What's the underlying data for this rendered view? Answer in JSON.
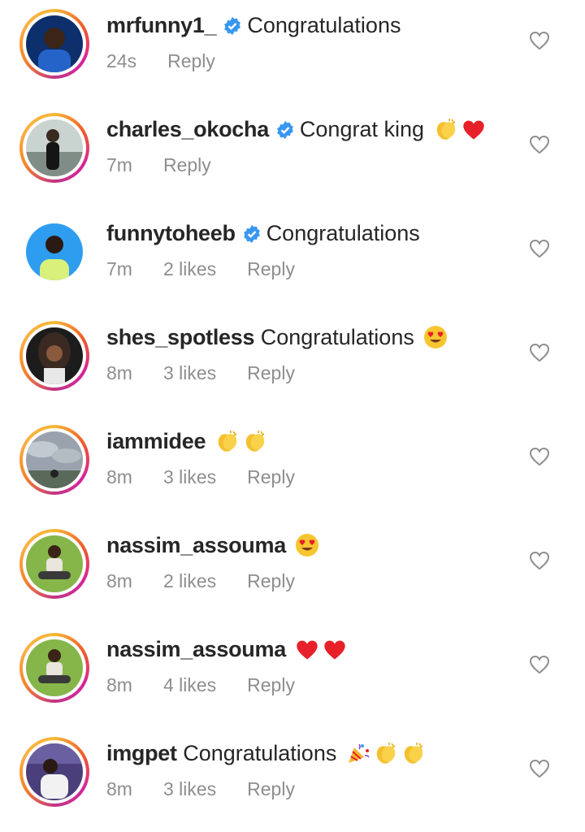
{
  "comments": [
    {
      "username": "mrfunny1_",
      "verified": true,
      "text": "Congratulations",
      "emojis": [],
      "time": "24s",
      "likes": "",
      "reply": "Reply",
      "ring": true,
      "avatar": "blue"
    },
    {
      "username": "charles_okocha",
      "verified": true,
      "text": "Congrat king",
      "emojis": [
        "clapping-hands",
        "red-heart"
      ],
      "time": "7m",
      "likes": "",
      "reply": "Reply",
      "ring": true,
      "avatar": "outdoor"
    },
    {
      "username": "funnytoheeb",
      "verified": true,
      "text": "Congratulations",
      "emojis": [],
      "time": "7m",
      "likes": "2 likes",
      "reply": "Reply",
      "ring": false,
      "avatar": "skyblue"
    },
    {
      "username": "shes_spotless",
      "verified": false,
      "text": "Congratulations",
      "emojis": [
        "heart-eyes"
      ],
      "time": "8m",
      "likes": "3 likes",
      "reply": "Reply",
      "ring": true,
      "avatar": "dark"
    },
    {
      "username": "iammidee",
      "verified": false,
      "text": "",
      "emojis": [
        "clapping-hands",
        "clapping-hands"
      ],
      "time": "8m",
      "likes": "3 likes",
      "reply": "Reply",
      "ring": true,
      "avatar": "cloudy"
    },
    {
      "username": "nassim_assouma",
      "verified": false,
      "text": "",
      "emojis": [
        "heart-eyes"
      ],
      "time": "8m",
      "likes": "2 likes",
      "reply": "Reply",
      "ring": true,
      "avatar": "green"
    },
    {
      "username": "nassim_assouma",
      "verified": false,
      "text": "",
      "emojis": [
        "red-heart",
        "red-heart"
      ],
      "time": "8m",
      "likes": "4 likes",
      "reply": "Reply",
      "ring": true,
      "avatar": "green"
    },
    {
      "username": "imgpet",
      "verified": false,
      "text": "Congratulations",
      "emojis": [
        "party-popper",
        "clapping-hands",
        "clapping-hands"
      ],
      "time": "8m",
      "likes": "3 likes",
      "reply": "Reply",
      "ring": true,
      "avatar": "purple"
    }
  ],
  "colors": {
    "verified": "#3897f0",
    "meta": "#8e8e8e",
    "text": "#262626"
  }
}
